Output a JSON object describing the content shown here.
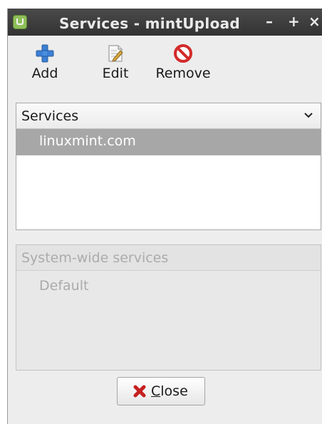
{
  "window": {
    "title": "Services - mintUpload",
    "minimize": "–",
    "maximize": "+",
    "close": "×"
  },
  "toolbar": {
    "add_label": "Add",
    "edit_label": "Edit",
    "remove_label": "Remove"
  },
  "services": {
    "header": "Services",
    "items": [
      "linuxmint.com"
    ],
    "selected_index": 0
  },
  "system_services": {
    "header": "System-wide services",
    "items": [
      "Default"
    ],
    "enabled": false
  },
  "footer": {
    "close_mnemonic": "C",
    "close_rest": "lose"
  },
  "colors": {
    "titlebar": "#3d3d3d",
    "selection": "#a7a7a7",
    "add_icon": "#3c7fd4",
    "remove_icon": "#d42a2a"
  }
}
